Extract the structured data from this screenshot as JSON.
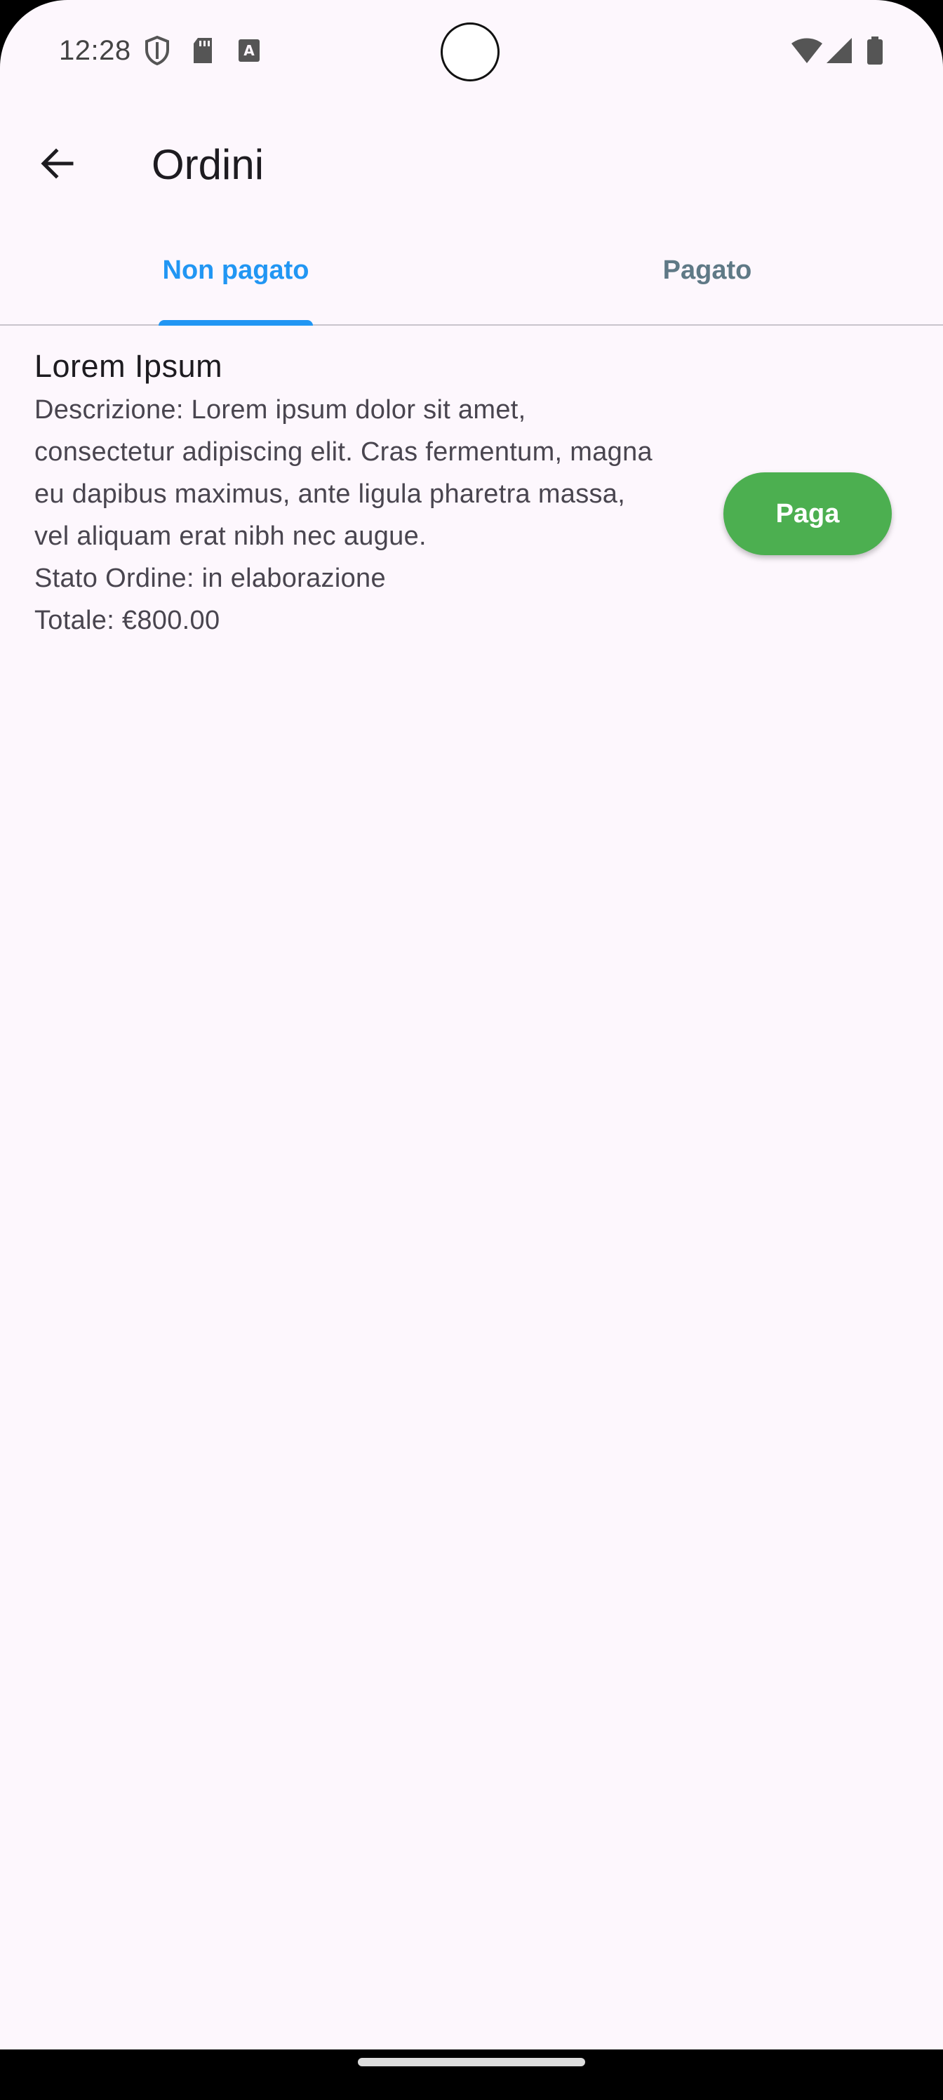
{
  "status_bar": {
    "time": "12:28",
    "icons": [
      "shield-icon",
      "sd-card-icon",
      "keyboard-a-icon",
      "wifi-icon",
      "signal-icon",
      "battery-icon"
    ]
  },
  "app_bar": {
    "back_icon": "arrow-back-icon",
    "title": "Ordini"
  },
  "tabs": [
    {
      "label": "Non pagato",
      "active": true
    },
    {
      "label": "Pagato",
      "active": false
    }
  ],
  "orders": [
    {
      "title": "Lorem Ipsum",
      "description": "Descrizione: Lorem ipsum dolor sit amet, consectetur adipiscing elit. Cras fermentum, magna eu dapibus maximus, ante ligula pharetra massa, vel aliquam erat nibh nec augue.",
      "status": "Stato Ordine: in elaborazione",
      "total": "Totale: €800.00",
      "pay_label": "Paga"
    }
  ],
  "colors": {
    "background": "#fdf7fd",
    "tab_active": "#2196f3",
    "tab_inactive": "#5f7986",
    "pay_button": "#4caf50"
  }
}
